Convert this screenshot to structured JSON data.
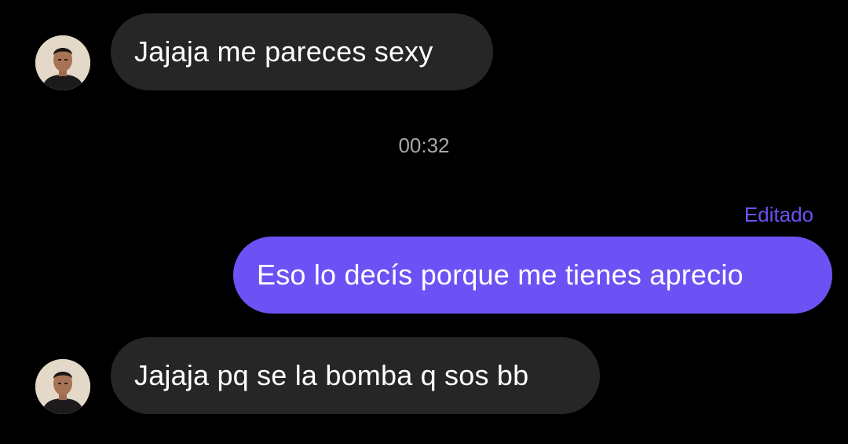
{
  "colors": {
    "background": "#000000",
    "incoming_bubble": "#262626",
    "outgoing_bubble": "#6c52f5",
    "edited_label": "#6c52f5",
    "timestamp": "#a8a8a8"
  },
  "messages": [
    {
      "direction": "incoming",
      "text": "Jajaja me pareces sexy",
      "avatar_icon": "contact-avatar-icon"
    },
    {
      "direction": "outgoing",
      "text": "Eso lo decís porque me tienes aprecio",
      "edited_label": "Editado"
    },
    {
      "direction": "incoming",
      "text": "Jajaja pq se la bomba q sos bb",
      "avatar_icon": "contact-avatar-icon"
    }
  ],
  "timestamp": "00:32"
}
